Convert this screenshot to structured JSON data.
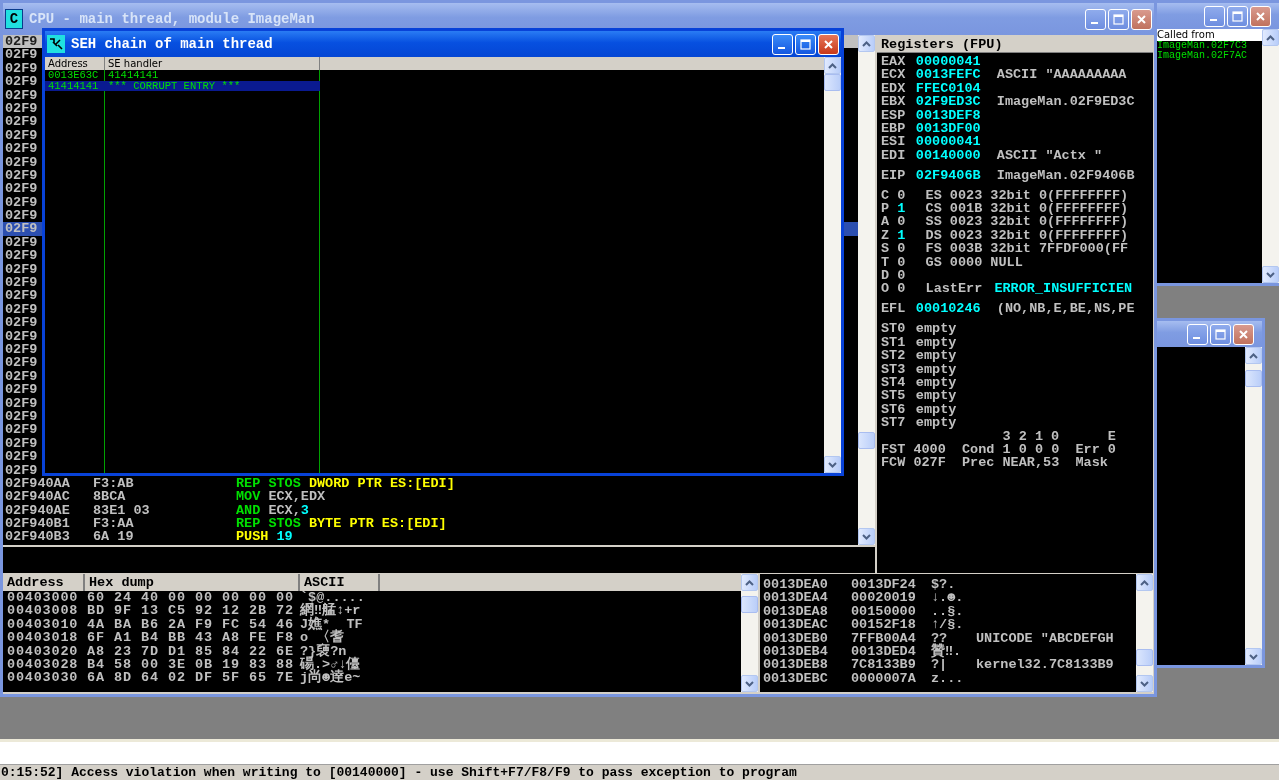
{
  "cpu_window": {
    "icon_letter": "C",
    "title": "CPU - main thread, module ImageMan",
    "active": false
  },
  "disassembly": {
    "rows": [
      {
        "address": "02F9",
        "selected": true,
        "current": false
      },
      {
        "address": "02F9",
        "selected": false,
        "current": false
      },
      {
        "address": "02F9",
        "selected": false,
        "current": false
      },
      {
        "address": "02F9",
        "selected": false,
        "current": false
      },
      {
        "address": "02F9",
        "selected": false,
        "current": false
      },
      {
        "address": "02F9",
        "selected": false,
        "current": false
      },
      {
        "address": "02F9",
        "selected": false,
        "current": false
      },
      {
        "address": "02F9",
        "selected": false,
        "current": false
      },
      {
        "address": "02F9",
        "selected": false,
        "current": false
      },
      {
        "address": "02F9",
        "selected": false,
        "current": false
      },
      {
        "address": "02F9",
        "selected": false,
        "current": false
      },
      {
        "address": "02F9",
        "selected": false,
        "current": false
      },
      {
        "address": "02F9",
        "selected": false,
        "current": false
      },
      {
        "address": "02F9",
        "selected": false,
        "current": false
      },
      {
        "address": "02F9",
        "selected": false,
        "current": true
      },
      {
        "address": "02F9",
        "selected": false,
        "current": false
      },
      {
        "address": "02F9",
        "selected": false,
        "current": false
      },
      {
        "address": "02F9",
        "selected": false,
        "current": false
      },
      {
        "address": "02F9",
        "selected": false,
        "current": false
      },
      {
        "address": "02F9",
        "selected": false,
        "current": false
      },
      {
        "address": "02F9",
        "selected": false,
        "current": false
      },
      {
        "address": "02F9",
        "selected": false,
        "current": false
      },
      {
        "address": "02F9",
        "selected": false,
        "current": false
      },
      {
        "address": "02F9",
        "selected": false,
        "current": false
      },
      {
        "address": "02F9",
        "selected": false,
        "current": false
      },
      {
        "address": "02F9",
        "selected": false,
        "current": false
      },
      {
        "address": "02F9",
        "selected": false,
        "current": false
      },
      {
        "address": "02F9",
        "selected": false,
        "current": false
      },
      {
        "address": "02F9",
        "selected": false,
        "current": false
      },
      {
        "address": "02F9",
        "selected": false,
        "current": false
      },
      {
        "address": "02F9",
        "selected": false,
        "current": false
      },
      {
        "address": "02F9",
        "selected": false,
        "current": false
      },
      {
        "address": "02F9",
        "selected": false,
        "current": false
      },
      {
        "address": "02F940AA",
        "hex": "F3:AB",
        "command": [
          {
            "text": "REP STOS ",
            "kind": "command"
          },
          {
            "text": "DWORD PTR ES:[EDI]",
            "kind": "memory"
          }
        ],
        "selected": false,
        "current": false
      },
      {
        "address": "02F940AC",
        "hex": "8BCA",
        "command": [
          {
            "text": "MOV ",
            "kind": "command"
          },
          {
            "text": "ECX,EDX",
            "kind": "operand"
          }
        ],
        "selected": false,
        "current": false
      },
      {
        "address": "02F940AE",
        "hex": "83E1 03",
        "command": [
          {
            "text": "AND ",
            "kind": "command"
          },
          {
            "text": "ECX,",
            "kind": "operand"
          },
          {
            "text": "3",
            "kind": "constant"
          }
        ],
        "selected": false,
        "current": false
      },
      {
        "address": "02F940B1",
        "hex": "F3:AA",
        "command": [
          {
            "text": "REP STOS ",
            "kind": "command"
          },
          {
            "text": "BYTE PTR ES:[EDI]",
            "kind": "memory"
          }
        ],
        "selected": false,
        "current": false
      },
      {
        "address": "02F940B3",
        "hex": "6A 19",
        "command": [
          {
            "text": "PUSH ",
            "kind": "stack_command"
          },
          {
            "text": "19",
            "kind": "constant"
          }
        ],
        "selected": false,
        "current": false
      }
    ]
  },
  "registers": {
    "title": "Registers (FPU)",
    "general": [
      {
        "name": "EAX",
        "value": "00000041"
      },
      {
        "name": "ECX",
        "value": "0013FEFC",
        "comment": "ASCII \"AAAAAAAAA"
      },
      {
        "name": "EDX",
        "value": "FFEC0104"
      },
      {
        "name": "EBX",
        "value": "02F9ED3C",
        "comment": "ImageMan.02F9ED3C"
      },
      {
        "name": "ESP",
        "value": "0013DEF8"
      },
      {
        "name": "EBP",
        "value": "0013DF00"
      },
      {
        "name": "ESI",
        "value": "00000041"
      },
      {
        "name": "EDI",
        "value": "00140000",
        "comment": "ASCII \"Actx \""
      }
    ],
    "eip": {
      "name": "EIP",
      "value": "02F9406B",
      "comment": "ImageMan.02F9406B"
    },
    "flags": [
      {
        "flag": "C",
        "bit": "0",
        "changed": false,
        "segment": "ES 0023 32bit 0(FFFFFFFF)"
      },
      {
        "flag": "P",
        "bit": "1",
        "changed": true,
        "segment": "CS 001B 32bit 0(FFFFFFFF)"
      },
      {
        "flag": "A",
        "bit": "0",
        "changed": false,
        "segment": "SS 0023 32bit 0(FFFFFFFF)"
      },
      {
        "flag": "Z",
        "bit": "1",
        "changed": true,
        "segment": "DS 0023 32bit 0(FFFFFFFF)"
      },
      {
        "flag": "S",
        "bit": "0",
        "changed": false,
        "segment": "FS 003B 32bit 7FFDF000(FF"
      },
      {
        "flag": "T",
        "bit": "0",
        "changed": false,
        "segment": "GS 0000 NULL"
      },
      {
        "flag": "D",
        "bit": "0",
        "changed": false
      },
      {
        "flag": "O",
        "bit": "0",
        "changed": false,
        "last_error_label": "LastErr",
        "last_error": "ERROR_INSUFFICIEN"
      }
    ],
    "efl": {
      "name": "EFL",
      "value": "00010246",
      "comment": "(NO,NB,E,BE,NS,PE"
    },
    "fpu": [
      {
        "name": "ST0",
        "value": "empty"
      },
      {
        "name": "ST1",
        "value": "empty"
      },
      {
        "name": "ST2",
        "value": "empty"
      },
      {
        "name": "ST3",
        "value": "empty"
      },
      {
        "name": "ST4",
        "value": "empty"
      },
      {
        "name": "ST5",
        "value": "empty"
      },
      {
        "name": "ST6",
        "value": "empty"
      },
      {
        "name": "ST7",
        "value": "empty"
      }
    ],
    "fpu_bits_header": "3 2 1 0      E",
    "fpu_status": [
      "FST 4000  Cond 1 0 0 0  Err 0",
      "FCW 027F  Prec NEAR,53  Mask"
    ]
  },
  "dump": {
    "columns": [
      "Address",
      "Hex dump",
      "ASCII"
    ],
    "rows": [
      {
        "address": "00403000",
        "hex": "60 24 40 00 00 00 00 00",
        "ascii": "`$@....."
      },
      {
        "address": "00403008",
        "hex": "BD 9F 13 C5 92 12 2B 72",
        "ascii": "網‼艋↕+r"
      },
      {
        "address": "00403010",
        "hex": "4A BA B6 2A F9 FC 54 46",
        "ascii": "J嫶*  TF"
      },
      {
        "address": "00403018",
        "hex": "6F A1 B4 BB 43 A8 FE F8",
        "ascii": "o 〈耆"
      },
      {
        "address": "00403020",
        "hex": "A8 23 7D D1 85 84 22 6E",
        "ascii": "?}褏?n"
      },
      {
        "address": "00403028",
        "hex": "B4 58 00 3E 0B 19 83 88",
        "ascii": "碭.>♂↓儓"
      },
      {
        "address": "00403030",
        "hex": "6A 8D 64 02 DF 5F 65 7E",
        "ascii": "j尚☻逹e~"
      }
    ]
  },
  "stack": {
    "rows": [
      {
        "address": "0013DEA0",
        "value": "0013DF24",
        "ascii": "$?."
      },
      {
        "address": "0013DEA4",
        "value": "00020019",
        "ascii": "↓.☻."
      },
      {
        "address": "0013DEA8",
        "value": "00150000",
        "ascii": "..§."
      },
      {
        "address": "0013DEAC",
        "value": "00152F18",
        "ascii": "↑/§."
      },
      {
        "address": "0013DEB0",
        "value": "7FFB00A4",
        "ascii": "??",
        "comment": "UNICODE \"ABCDEFGH"
      },
      {
        "address": "0013DEB4",
        "value": "0013DED4",
        "ascii": "贊‼."
      },
      {
        "address": "0013DEB8",
        "value": "7C8133B9",
        "ascii": "?|",
        "comment": "kernel32.7C8133B9"
      },
      {
        "address": "0013DEBC",
        "value": "0000007A",
        "ascii": "z..."
      }
    ]
  },
  "seh_window": {
    "title": "SEH chain of main thread",
    "active": true,
    "columns": [
      "Address",
      "SE handler"
    ],
    "rows": [
      {
        "address": "0013E63C",
        "handler": "41414141",
        "selected": false
      },
      {
        "address": "41414141",
        "handler": "*** CORRUPT ENTRY ***",
        "selected": true
      }
    ]
  },
  "call_stack_window": {
    "active": false,
    "header": "Called from",
    "rows": [
      "ImageMan.02F7C3",
      "ImageMan.02F7AC"
    ]
  },
  "side_window": {
    "active": false
  },
  "status_bar": {
    "text": "0:15:52] Access violation when writing to [00140000] - use Shift+F7/F8/F9 to pass exception to program"
  }
}
